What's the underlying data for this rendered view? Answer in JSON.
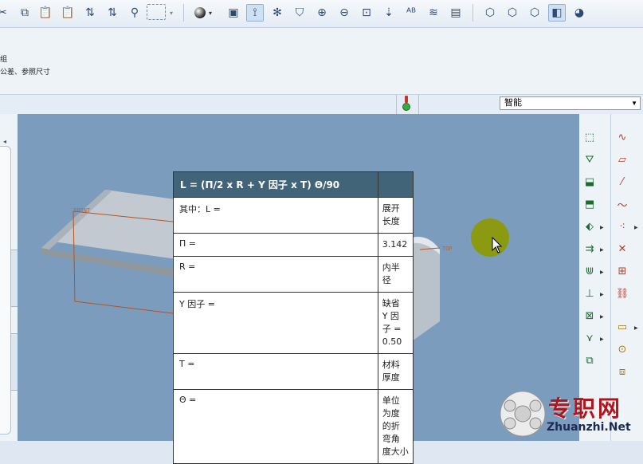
{
  "toolbar": {
    "icons": [
      "cut-icon",
      "copy-icon",
      "paste-icon",
      "paste-special-icon",
      "regenerate-icon",
      "regenerate-manager-icon",
      "find-icon",
      "select-box-icon",
      "select-dropdown-icon",
      "shade-icon",
      "refit-icon",
      "datum-display-icon",
      "spin-center-icon",
      "view-manager-icon",
      "zoom-in-icon",
      "zoom-out-icon",
      "zoom-fit-icon",
      "orient-icon",
      "annotation-display-icon",
      "layers-icon",
      "saved-views-icon",
      "wireframe-icon",
      "hidden-line-icon",
      "no-hidden-icon",
      "shading-icon",
      "appearance-icon"
    ]
  },
  "messages": {
    "line1": "组",
    "line2": "公差、参照尺寸"
  },
  "status": {
    "filter_value": "智能"
  },
  "viewport": {
    "front_label": "FRONT",
    "top_label": "TOP"
  },
  "formula": {
    "header": "L = (Π/2 x R + Y 因子 x T) Θ/90",
    "rows": [
      {
        "term": "其中：L =",
        "desc": [
          "展开",
          "长度"
        ]
      },
      {
        "term": "Π =",
        "desc": [
          "3.142"
        ]
      },
      {
        "term": "R =",
        "desc": [
          "内半",
          "径"
        ]
      },
      {
        "term": "Y 因子 =",
        "desc": [
          "缺省",
          "Y 因",
          "子 =",
          "0.50"
        ]
      },
      {
        "term": "T =",
        "desc": [
          "材料",
          "厚度"
        ]
      },
      {
        "term": "Θ =",
        "desc": [
          "单位",
          "为度",
          "的折",
          "弯角",
          "度大小"
        ]
      }
    ]
  },
  "watermark": {
    "cn": "专职网",
    "en": "Zhuanzhi.Net"
  }
}
